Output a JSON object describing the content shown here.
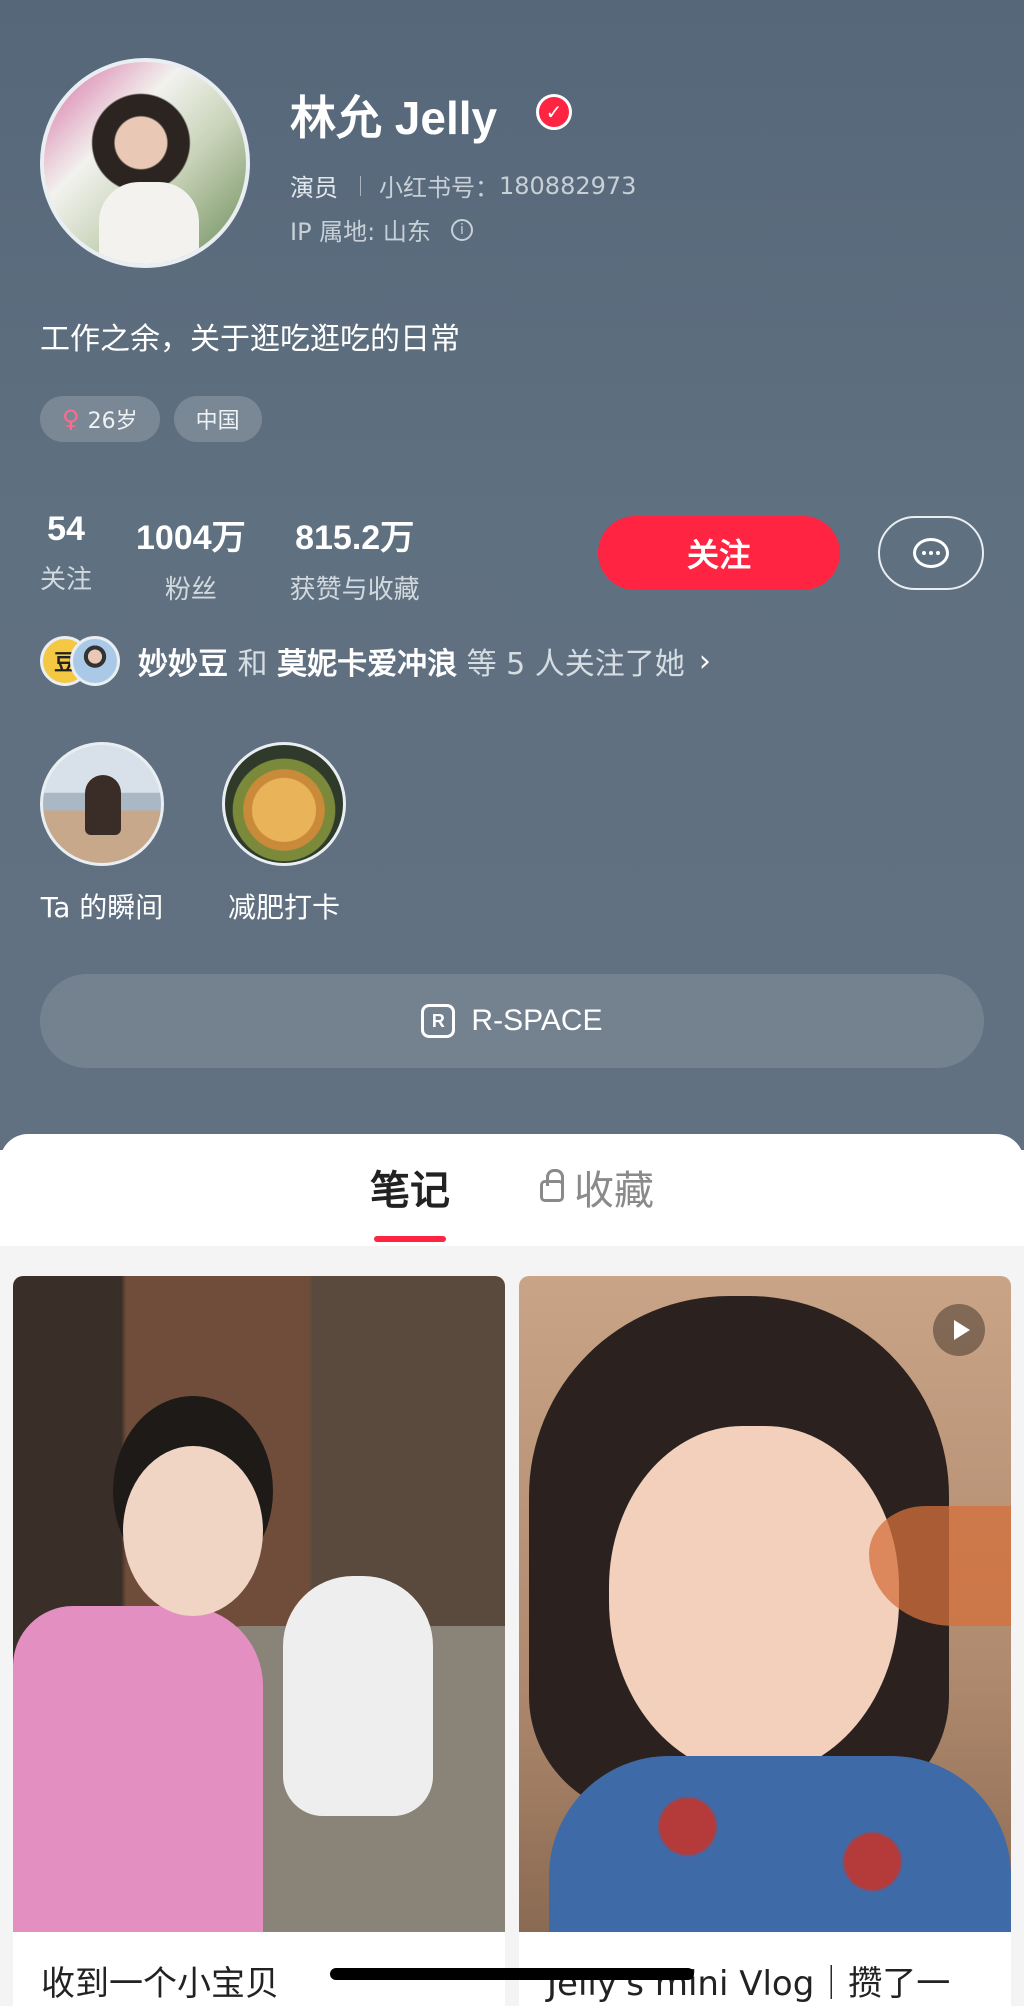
{
  "profile": {
    "name": "林允 Jelly",
    "occupation": "演员",
    "id_label": "小红书号：",
    "id_value": "180882973",
    "ip_location": "IP 属地: 山东",
    "bio": "工作之余，关于逛吃逛吃的日常",
    "tags": [
      "26岁",
      "中国"
    ]
  },
  "stats": [
    {
      "value": "54",
      "label": "关注"
    },
    {
      "value": "1004万",
      "label": "粉丝"
    },
    {
      "value": "815.2万",
      "label": "获赞与收藏"
    }
  ],
  "actions": {
    "follow_label": "关注",
    "message_icon": "chat-bubble-icon"
  },
  "mutual": {
    "avatar_a_text": "豆",
    "user1": "妙妙豆",
    "connector": "和",
    "user2": "莫妮卡爱冲浪",
    "suffix": "等 5 人关注了她",
    "chevron": "›"
  },
  "highlights": [
    {
      "label": "Ta 的瞬间"
    },
    {
      "label": "减肥打卡"
    }
  ],
  "rspace": {
    "label": "R-SPACE",
    "icon_text": "R"
  },
  "tabs": [
    {
      "label": "笔记",
      "active": true
    },
    {
      "label": "收藏",
      "active": false,
      "icon": "lock-icon"
    }
  ],
  "notes": [
    {
      "title": "收到一个小宝贝"
    },
    {
      "title": "Jelly's mini Vlog｜攒了一",
      "is_video": true
    }
  ],
  "colors": {
    "accent": "#ff2442",
    "header_bg": "#5f7080"
  }
}
